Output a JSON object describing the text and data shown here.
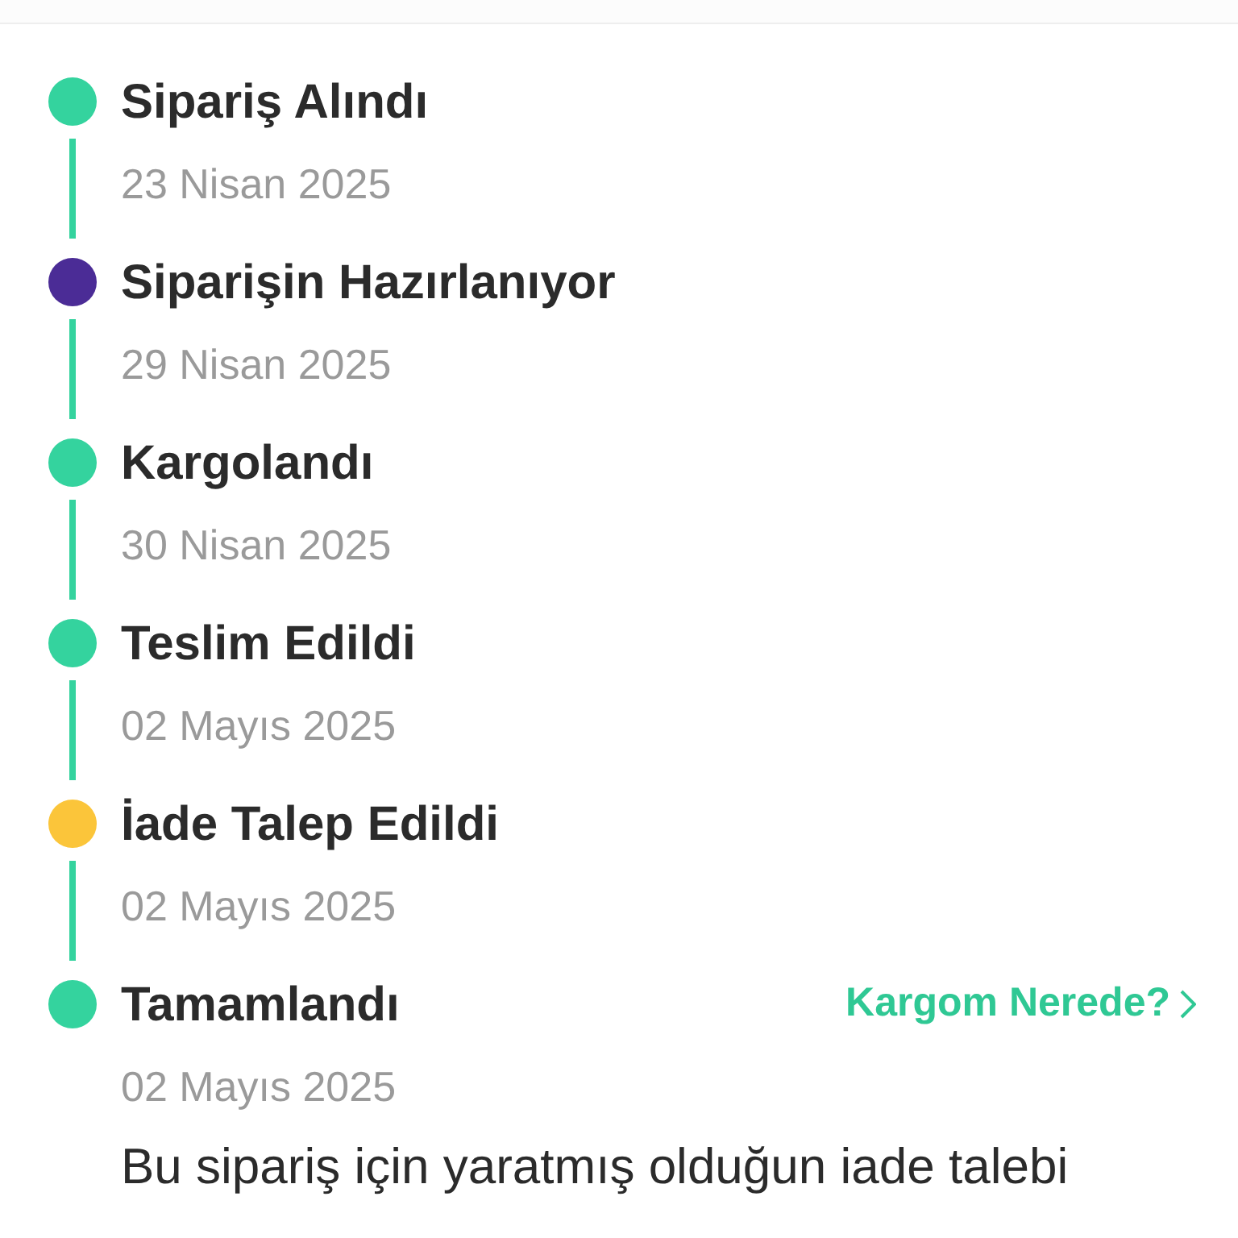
{
  "steps": [
    {
      "title": "Sipariş Alındı",
      "date": "23 Nisan 2025",
      "color": "#34d39e"
    },
    {
      "title": "Siparişin Hazırlanıyor",
      "date": "29 Nisan 2025",
      "color": "#4b2c96"
    },
    {
      "title": "Kargolandı",
      "date": "30 Nisan 2025",
      "color": "#34d39e"
    },
    {
      "title": "Teslim Edildi",
      "date": "02 Mayıs 2025",
      "color": "#34d39e"
    },
    {
      "title": "İade Talep Edildi",
      "date": "02 Mayıs 2025",
      "color": "#fbc53a"
    },
    {
      "title": "Tamamlandı",
      "date": "02 Mayıs 2025",
      "color": "#34d39e",
      "link": "Kargom Nerede?"
    }
  ],
  "note": "Bu sipariş için yaratmış olduğun iade talebi"
}
